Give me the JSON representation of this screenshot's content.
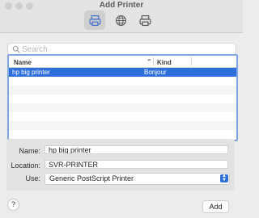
{
  "window": {
    "title": "Add Printer"
  },
  "toolbar": {
    "buttons": [
      {
        "icon": "printer-icon",
        "active": true
      },
      {
        "icon": "globe-icon",
        "active": false
      },
      {
        "icon": "windows-printer-icon",
        "active": false
      }
    ]
  },
  "search": {
    "placeholder": "Search",
    "value": ""
  },
  "list": {
    "columns": [
      "Name",
      "Kind"
    ],
    "rows": [
      {
        "name": "hp big printer",
        "kind": "Bonjour",
        "selected": true
      }
    ]
  },
  "form": {
    "name_label": "Name:",
    "name_value": "hp big printer",
    "location_label": "Location:",
    "location_value": "SVR-PRINTER",
    "use_label": "Use:",
    "use_value": "Generic PostScript Printer"
  },
  "footer": {
    "help_label": "?",
    "add_label": "Add"
  },
  "colors": {
    "accent": "#2f6fdb",
    "focus_ring": "#7fa6e0"
  }
}
